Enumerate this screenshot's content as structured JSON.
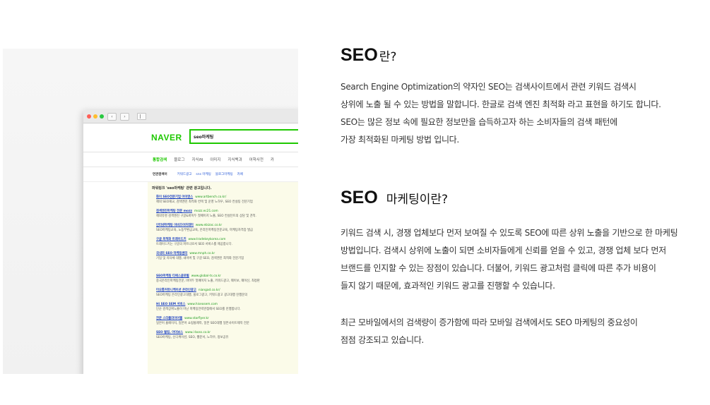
{
  "browser": {
    "search_query": "seo마케팅",
    "logo": "NAVER",
    "tabs": [
      "통합검색",
      "블로그",
      "지식iN",
      "이미지",
      "지식백과",
      "어학사전",
      "카"
    ],
    "related_label": "연관검색어",
    "related": [
      "키워드광고",
      "sns 마케팅",
      "블로그마케팅",
      "카페"
    ],
    "ads_title": "파워링크 'seo마케팅' 관련 광고입니다.",
    "ads": [
      {
        "title": "화이 SEO전문기업 아이엔스",
        "url": "www.artbench.co.kr/",
        "desc": "해외 SEO재교, 검색엔진 최적화 컨택 및 운영 노하우, SEO 컨설팅 전문기업"
      },
      {
        "title": "검색엔진마케팅 전문 mozz",
        "url": "mozz.ec21.com",
        "desc": "해외유명 검색엔진 구글&바이두 첫페이지 노출, SEO 컨설턴트의 상담 및 견적."
      },
      {
        "title": "인터넷마케팅 이비즈아카데미",
        "url": "www.ebizac.co.kr",
        "desc": "SEO마케팅교육, 노동부환급교육, 온라인마케팅전문교육, 마케팅자격증 발급"
      },
      {
        "title": "구글 최적화 트레이드키",
        "url": "www.tradekeykorea.com",
        "desc": "트레이드키는 구글의 파트너로서 SEO 서비스를 제공합니다."
      },
      {
        "title": "국내외 SEO 마케팅센터",
        "url": "www.mnph.co.kr",
        "desc": "기업 및 지자체 대행, 네이버 및 구글 SEO, 검색엔진 최적화 전문기업"
      },
      {
        "title": "SEO마케팅 티에스글로벌",
        "url": "www.global-ts.co.kr",
        "desc": "중국온라인마케팅전문, 바이두 첫페이지 노출, 키워드광고, 웨이보, 웨이신, 최정판"
      },
      {
        "title": "미오통커뮤니케이션 온라인광고",
        "url": "niangad.co.kr/",
        "desc": "SEO마케팅 온라인광고대행, 블로그광고, 키워드광고 광고대행 진행문의"
      },
      {
        "title": "Hi SEO SEM 서비스",
        "url": "www.hiseosem.com",
        "desc": "단순 검색상위노출이 아닌 마케팅전략관점에서 SEO를 진행합니다."
      },
      {
        "title": "전문 스타플라이어웹",
        "url": "www.starflyer.kr",
        "desc": "일본어 홈페이지, 일본어 쇼핑몰제작, 일본 SEO대행 일본사이트제작 전문"
      },
      {
        "title": "SEO 될링, 아이보스",
        "url": "www.i-boss.co.kr",
        "desc": "SEO마케팅, 신디케이션, SEO, 웹문서, 노하우, 정보공유"
      }
    ]
  },
  "section1": {
    "title_en": "SEO",
    "title_kr": "란?",
    "lines": [
      "Search Engine Optimization의 약자인 SEO는 검색사이트에서 관련 키워드 검색시",
      "상위에 노출 될 수 있는 방법을 말합니다. 한글로 검색 엔진 최적화 라고 표현을 하기도 합니다.",
      "SEO는 많은 정보 속에 필요한 정보만을 습득하고자 하는 소비자들의 검색 패턴에",
      "가장 최적화된 마케팅 방법 입니다."
    ]
  },
  "section2": {
    "title_en": "SEO",
    "title_kr": "마케팅이란?",
    "lines": [
      "키워드 검색 시, 경쟁 업체보다 먼저 보여질 수 있도록 SEO에 따른 상위 노출을 기반으로 한 마케팅",
      "방법입니다. 검색시 상위에 노출이 되면 소비자들에게 신뢰를 얻을 수 있고, 경쟁 업체 보다 먼저",
      "브랜드를 인지할 수 있는 장점이 있습니다. 더불어, 키워드 광고처럼 클릭에 따른 추가 비용이",
      "들지 않기 때문에, 효과적인 키워드 광고를 진행할 수 있습니다."
    ],
    "lines2": [
      "최근 모바일에서의 검색량이 증가함에 따라 모바일 검색에서도 SEO 마케팅의 중요성이",
      "점점 강조되고 있습니다."
    ]
  }
}
